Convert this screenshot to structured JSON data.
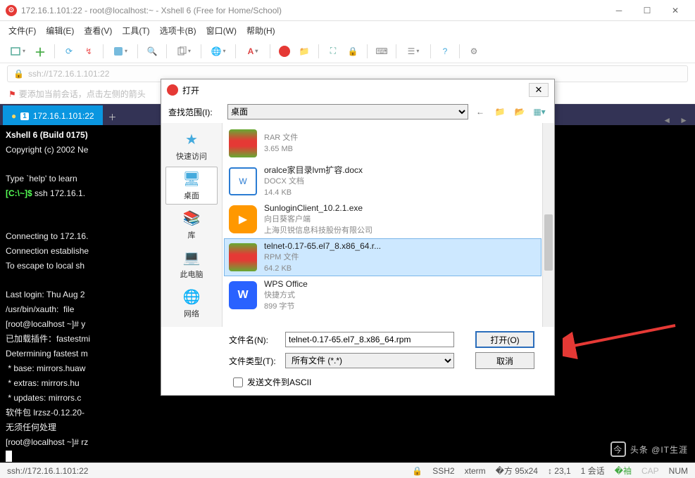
{
  "window": {
    "title": "172.16.1.101:22 - root@localhost:~ - Xshell 6 (Free for Home/School)"
  },
  "menu": {
    "file": "文件(F)",
    "edit": "编辑(E)",
    "view": "查看(V)",
    "tools": "工具(T)",
    "tabs": "选项卡(B)",
    "window": "窗口(W)",
    "help": "帮助(H)"
  },
  "addr": {
    "url": "ssh://172.16.1.101:22"
  },
  "hint": {
    "text": "要添加当前会话，点击左侧的箭头"
  },
  "tab": {
    "num": "1",
    "label": "172.16.1.101:22"
  },
  "terminal": {
    "line1": "Xshell 6 (Build 0175)",
    "line2": "Copyright (c) 2002 Ne",
    "line3": "Type `help' to learn ",
    "prompt1_a": "[C:\\~]$",
    "prompt1_b": " ssh 172.16.1.",
    "line4": "Connecting to 172.16.",
    "line5": "Connection establishe",
    "line6": "To escape to local sh",
    "line7": "Last login: Thu Aug 2",
    "line8": "/usr/bin/xauth:  file",
    "line9": "[root@localhost ~]# y",
    "line10": "已加载插件：fastestmi",
    "line11": "Determining fastest m",
    "line12": " * base: mirrors.huaw",
    "line13": " * extras: mirrors.hu",
    "line14": " * updates: mirrors.c",
    "line15": "软件包 lrzsz-0.12.20-",
    "line16": "无须任何处理",
    "line17": "[root@localhost ~]# rz"
  },
  "status": {
    "addr": "ssh://172.16.1.101:22",
    "ssh": "SSH2",
    "term": "xterm",
    "size": "95x24",
    "pos": "23,1",
    "session": "1 会话",
    "cap": "CAP",
    "num": "NUM"
  },
  "dialog": {
    "title": "打开",
    "lookin_label": "查找范围(I):",
    "lookin_value": "桌面",
    "side": {
      "quick": "快速访问",
      "desktop": "桌面",
      "library": "库",
      "thispc": "此电脑",
      "network": "网络"
    },
    "files": [
      {
        "name": "",
        "type": "RAR 文件",
        "size": "3.65 MB",
        "icon": "rar"
      },
      {
        "name": "oralce家目录lvm扩容.docx",
        "type": "DOCX 文档",
        "size": "14.4 KB",
        "icon": "docx"
      },
      {
        "name": "SunloginClient_10.2.1.exe",
        "type": "向日葵客户端",
        "size": "上海贝锐信息科技股份有限公司",
        "icon": "exe"
      },
      {
        "name": "telnet-0.17-65.el7_8.x86_64.r...",
        "type": "RPM 文件",
        "size": "64.2 KB",
        "icon": "rpm",
        "selected": true
      },
      {
        "name": "WPS Office",
        "type": "快捷方式",
        "size": "899 字节",
        "icon": "wps"
      }
    ],
    "filename_label": "文件名(N):",
    "filename_value": "telnet-0.17-65.el7_8.x86_64.rpm",
    "filetype_label": "文件类型(T):",
    "filetype_value": "所有文件 (*.*)",
    "open_btn": "打开(O)",
    "cancel_btn": "取消",
    "ascii_label": "发送文件到ASCII"
  },
  "watermark": {
    "text": "头条 @IT生涯"
  }
}
